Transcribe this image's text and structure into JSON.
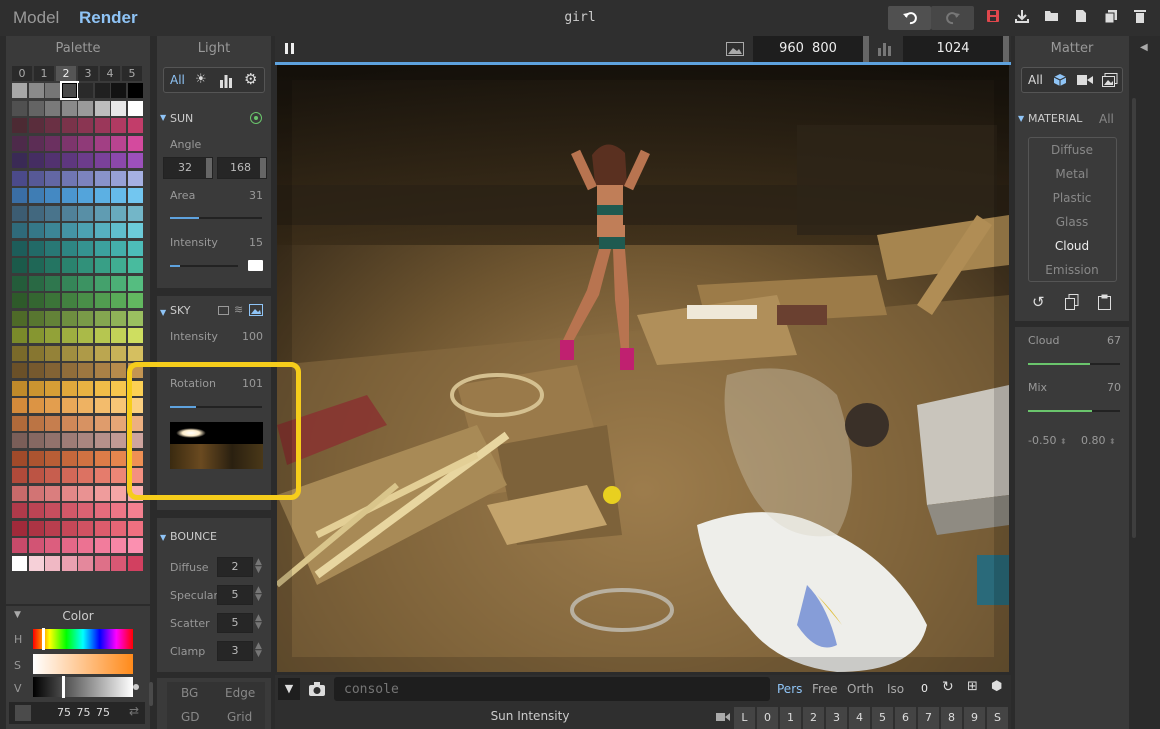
{
  "header": {
    "modes": [
      "Model",
      "Render"
    ],
    "title": "girl"
  },
  "palette": {
    "title": "Palette",
    "tabs": [
      "0",
      "1",
      "2",
      "3",
      "4",
      "5"
    ],
    "active_tab": "2",
    "color_rows": [
      [
        "#a8a8a8",
        "#8a8a8a",
        "#767676",
        "#4a4a4a",
        "#2a2a2a",
        "#202020",
        "#121212",
        "#000000"
      ],
      [
        "#505050",
        "#646464",
        "#7a7a7a",
        "#8a8a8a",
        "#9a9a9a",
        "#bdbdbd",
        "#e8e8e8",
        "#ffffff"
      ],
      [
        "#4c2a33",
        "#5a2d3c",
        "#6a3044",
        "#7a334a",
        "#8a3552",
        "#9b375a",
        "#b03a62",
        "#c23d6a"
      ],
      [
        "#4d2a4a",
        "#5c2d55",
        "#6b3060",
        "#7d356c",
        "#8f3a78",
        "#a23f84",
        "#b84490",
        "#d44a9e"
      ],
      [
        "#3a2a55",
        "#452d62",
        "#523270",
        "#5e377e",
        "#6c3c8c",
        "#7a419a",
        "#8b48ab",
        "#9c50bb"
      ],
      [
        "#4b4a8a",
        "#575996",
        "#6367a4",
        "#7076b2",
        "#7c83be",
        "#8993ca",
        "#97a1d6",
        "#a6b0e2"
      ],
      [
        "#3a6ea5",
        "#3f7db4",
        "#4489c3",
        "#4b96cf",
        "#53a4db",
        "#5cb0e3",
        "#66bbea",
        "#72c6f0"
      ],
      [
        "#3c5c72",
        "#42687f",
        "#49748c",
        "#508199",
        "#588fa6",
        "#609cb2",
        "#68aabd",
        "#73b6c8"
      ],
      [
        "#2f6a7a",
        "#357888",
        "#3c8697",
        "#4494a5",
        "#4ca2b2",
        "#56b0c0",
        "#60becd",
        "#6ccbd9"
      ],
      [
        "#1d5d5a",
        "#226a67",
        "#287875",
        "#2e8683",
        "#359390",
        "#3ca19e",
        "#44afab",
        "#4dbcb8"
      ],
      [
        "#1b5a4a",
        "#1f6756",
        "#247562",
        "#2a836e",
        "#31917a",
        "#389f86",
        "#40ad92",
        "#48bb9e"
      ],
      [
        "#245c3a",
        "#296944",
        "#2f774e",
        "#358558",
        "#3c9362",
        "#44a16c",
        "#4caf76",
        "#55bd80"
      ],
      [
        "#2e5a2a",
        "#346631",
        "#3b7438",
        "#428140",
        "#498e48",
        "#519c50",
        "#59aa58",
        "#62b860"
      ],
      [
        "#4e6a28",
        "#587630",
        "#638238",
        "#6e8e40",
        "#799a48",
        "#84a650",
        "#8fb258",
        "#9abf60"
      ],
      [
        "#7a8a2a",
        "#869630",
        "#92a238",
        "#9eae40",
        "#aaba48",
        "#b6c650",
        "#c2d258",
        "#cede60"
      ],
      [
        "#7a6a2a",
        "#877630",
        "#948238",
        "#a18e40",
        "#ae9a48",
        "#bba650",
        "#c8b258",
        "#d5bf60"
      ],
      [
        "#6a5028",
        "#76592e",
        "#836334",
        "#906d3a",
        "#9d7740",
        "#aa8146",
        "#b78b4c",
        "#c49552"
      ],
      [
        "#c08a2a",
        "#cb9430",
        "#d69e36",
        "#e0a83c",
        "#e8b242",
        "#f0bc48",
        "#f6c64e",
        "#fcd054"
      ],
      [
        "#d48a3a",
        "#dc9444",
        "#e39e4e",
        "#e9a858",
        "#eeb262",
        "#f3bc6c",
        "#f7c676",
        "#fbd080"
      ],
      [
        "#b06a3a",
        "#bb7444",
        "#c67e4e",
        "#cf8858",
        "#d79262",
        "#df9c6c",
        "#e6a676",
        "#edb080"
      ],
      [
        "#7a5e58",
        "#866862",
        "#92726c",
        "#9e7c76",
        "#aa8680",
        "#b6908a",
        "#c29a94",
        "#cea49e"
      ],
      [
        "#a04a2a",
        "#ac5430",
        "#b85e36",
        "#c4683c",
        "#d07242",
        "#dc7c48",
        "#e6864e",
        "#ef9054"
      ],
      [
        "#b04a3a",
        "#bc5444",
        "#c75e4e",
        "#d26858",
        "#dc7262",
        "#e57c6c",
        "#ed8676",
        "#f49080"
      ],
      [
        "#c86a6a",
        "#d27474",
        "#da7e7e",
        "#e28888",
        "#e99292",
        "#ef9c9c",
        "#f4a6a6",
        "#f8b0b0"
      ],
      [
        "#b03a4a",
        "#bc4454",
        "#c74e5e",
        "#d25868",
        "#dc6272",
        "#e56c7c",
        "#ed7686",
        "#f48090"
      ],
      [
        "#a02a3a",
        "#ac3444",
        "#b83e4e",
        "#c44858",
        "#d05262",
        "#dc5c6c",
        "#e66676",
        "#ef7080"
      ],
      [
        "#c84a6a",
        "#d25474",
        "#dc5e7e",
        "#e46888",
        "#ec7292",
        "#f27c9c",
        "#f786a6",
        "#fb90b0"
      ],
      [
        "#ffffff",
        "#f6d0d8",
        "#f0b8c4",
        "#eaa0b0",
        "#e4889c",
        "#de7088",
        "#d85874",
        "#d24060"
      ]
    ],
    "selected_color": "#6a6a6a",
    "color_section": "Color",
    "hsv_labels": [
      "H",
      "S",
      "V"
    ],
    "rgb": "75 75 75"
  },
  "light": {
    "title": "Light",
    "tabs": [
      "All"
    ],
    "sun": {
      "label": "SUN",
      "angle_label": "Angle",
      "angle_values": [
        "32",
        "168"
      ],
      "area_label": "Area",
      "area_value": "31",
      "area_fraction": 0.31,
      "intensity_label": "Intensity",
      "intensity_value": "15",
      "intensity_fraction": 0.15
    },
    "sky": {
      "label": "SKY",
      "intensity_label": "Intensity",
      "intensity_value": "100",
      "rotation_label": "Rotation",
      "rotation_value": "101",
      "rotation_fraction": 0.28
    },
    "bounce": {
      "label": "BOUNCE",
      "rows": [
        {
          "label": "Diffuse",
          "value": "2"
        },
        {
          "label": "Specular",
          "value": "5"
        },
        {
          "label": "Scatter",
          "value": "5"
        },
        {
          "label": "Clamp",
          "value": "3"
        }
      ]
    },
    "bottom_buttons": [
      "BG",
      "Edge",
      "GD",
      "Grid"
    ]
  },
  "viewport": {
    "resolution": "960  800",
    "samples": "1024"
  },
  "matter": {
    "title": "Matter",
    "tabs": [
      "All"
    ],
    "section": "MATERIAL",
    "section_filter": "All",
    "materials": [
      "Diffuse",
      "Metal",
      "Plastic",
      "Glass",
      "Cloud",
      "Emission"
    ],
    "active_material": "Cloud",
    "cloud_label": "Cloud",
    "cloud_value": "67",
    "cloud_fraction": 0.67,
    "mix_label": "Mix",
    "mix_value": "70",
    "mix_fraction": 0.7,
    "range_values": [
      "-0.50",
      "0.80"
    ]
  },
  "bottom": {
    "console_placeholder": "console",
    "views": [
      "Pers",
      "Free",
      "Orth",
      "Iso"
    ],
    "active_view": "Pers",
    "zero_label": "0",
    "status": "Sun Intensity",
    "keys": [
      "L",
      "0",
      "1",
      "2",
      "3",
      "4",
      "5",
      "6",
      "7",
      "8",
      "9",
      "S"
    ]
  }
}
